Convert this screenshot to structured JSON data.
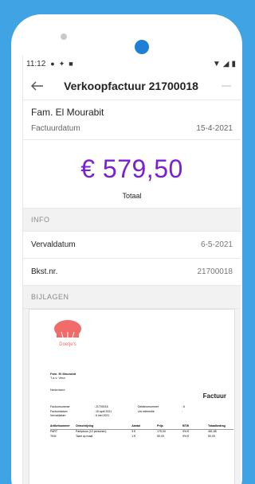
{
  "status_bar": {
    "time": "11:12"
  },
  "app_bar": {
    "title": "Verkoopfactuur 21700018"
  },
  "invoice": {
    "customer": "Fam. El Mourabit",
    "date_label": "Factuurdatum",
    "date_value": "15-4-2021",
    "amount": "€ 579,50",
    "amount_label": "Totaal"
  },
  "info": {
    "section_label": "INFO",
    "rows": [
      {
        "label": "Vervaldatum",
        "value": "6-5-2021"
      },
      {
        "label": "Bkst.nr.",
        "value": "21700018"
      }
    ]
  },
  "attachments": {
    "section_label": "BIJLAGEN",
    "doc": {
      "logo_text": "Doetje's",
      "addr_line1": "Fam. El Mourabit",
      "addr_line2": "T.a.v.   Vera",
      "country": "Nederland",
      "heading": "Factuur",
      "meta": [
        [
          "Factuurnummer",
          ": 21700018",
          "Debiteurnummer",
          ": 6"
        ],
        [
          "Factuurdatum",
          ": 15 april 2021",
          "Uw referentie",
          ":"
        ],
        [
          "Vervaldatum",
          ": 6 mei 2021",
          "",
          ""
        ]
      ],
      "table_head": [
        "Artikelnummer",
        "Omschrijving",
        "Aantal",
        "Prijs",
        "BTW",
        "Totaalbedrag"
      ],
      "table_rows": [
        [
          "PART",
          "Partydoos (10 personen)",
          "3 €",
          "175,00",
          "9%  €",
          "481,85"
        ],
        [
          "TKM",
          "Taart op maat",
          "1 €",
          "50,00",
          "9%  €",
          "50,00"
        ]
      ]
    }
  },
  "colors": {
    "background": "#3fa3e4",
    "accent": "#7a1fd6",
    "camera": "#1f7fd6",
    "logo": "#f26b6b"
  }
}
